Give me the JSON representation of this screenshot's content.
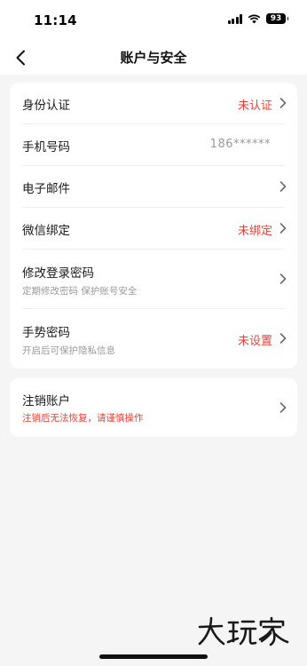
{
  "status_bar": {
    "time": "11:14",
    "battery": "93"
  },
  "nav": {
    "title": "账户与安全"
  },
  "rows": [
    {
      "label": "身份认证",
      "value": "未认证"
    },
    {
      "label": "手机号码",
      "value": "186******"
    },
    {
      "label": "电子邮件"
    },
    {
      "label": "微信绑定",
      "value": "未绑定"
    },
    {
      "label": "修改登录密码",
      "subtitle": "定期修改密码 保护账号安全"
    },
    {
      "label": "手势密码",
      "subtitle": "开启后可保护隐私信息",
      "value": "未设置"
    }
  ],
  "cancel_account": {
    "label": "注销账户",
    "subtitle": "注销后无法恢复，请谨慎操作"
  },
  "watermark": "大玩家",
  "colors": {
    "accent_red": "#e5423b",
    "background": "#f5f5f6",
    "card": "#ffffff",
    "muted_text": "#9a9a9a"
  }
}
